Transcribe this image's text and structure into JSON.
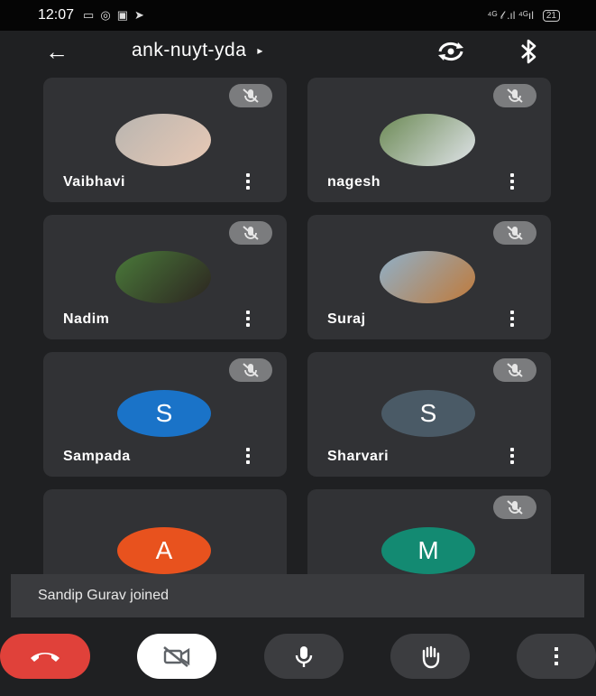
{
  "status_bar": {
    "time": "12:07",
    "notification_icons": [
      "cast-icon",
      "whatsapp-icon",
      "chat-icon",
      "send-icon"
    ],
    "right_text": "⁴ᴳ 𝓁 .ıl ⁴ᴳıl",
    "battery": "21"
  },
  "header": {
    "meeting_code": "ank-nuyt-yda",
    "caret": "▸"
  },
  "participants": [
    {
      "name": "Vaibhavi",
      "avatar_type": "photo",
      "photo_colors": [
        "#b9b5b0",
        "#e8c9b5"
      ]
    },
    {
      "name": "nagesh",
      "avatar_type": "photo",
      "photo_colors": [
        "#6c8a55",
        "#dfe3e8"
      ]
    },
    {
      "name": "Nadim",
      "avatar_type": "photo",
      "photo_colors": [
        "#4a7a3a",
        "#2c2420"
      ]
    },
    {
      "name": "Suraj",
      "avatar_type": "photo",
      "photo_colors": [
        "#8fb0c9",
        "#c07a3a"
      ]
    },
    {
      "name": "Sampada",
      "avatar_type": "letter",
      "letter": "S",
      "color": "#1a73c8"
    },
    {
      "name": "Sharvari",
      "avatar_type": "letter",
      "letter": "S",
      "color": "#4a5a66"
    },
    {
      "name": "",
      "avatar_type": "letter",
      "letter": "A",
      "color": "#e8521e"
    },
    {
      "name": "",
      "avatar_type": "letter",
      "letter": "M",
      "color": "#138a72"
    }
  ],
  "toast": {
    "message": "Sandip Gurav joined"
  },
  "colors": {
    "end_call": "#e0413a",
    "background": "#1f2022",
    "tile": "#313235"
  }
}
